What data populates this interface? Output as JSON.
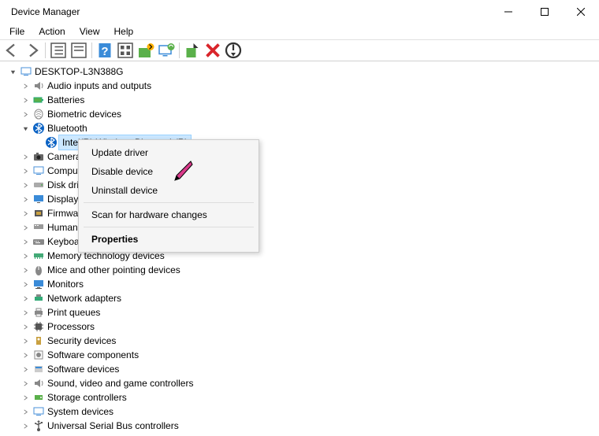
{
  "window": {
    "title": "Device Manager"
  },
  "menu": {
    "file": "File",
    "action": "Action",
    "view": "View",
    "help": "Help"
  },
  "tree": {
    "root": "DESKTOP-L3N388G",
    "audio": "Audio inputs and outputs",
    "batteries": "Batteries",
    "biometric": "Biometric devices",
    "bluetooth": "Bluetooth",
    "bt_device": "Intel(R) Wireless Bluetooth(R)",
    "cameras": "Cameras",
    "computer": "Computer",
    "disk": "Disk drives",
    "display": "Display adapters",
    "firmware": "Firmware",
    "hid": "Human Interface Devices",
    "keyboards": "Keyboards",
    "memory": "Memory technology devices",
    "mice": "Mice and other pointing devices",
    "monitors": "Monitors",
    "network": "Network adapters",
    "printqueues": "Print queues",
    "processors": "Processors",
    "security": "Security devices",
    "softcomp": "Software components",
    "softdev": "Software devices",
    "sound": "Sound, video and game controllers",
    "storage": "Storage controllers",
    "system": "System devices",
    "usb": "Universal Serial Bus controllers"
  },
  "context_menu": {
    "update_driver": "Update driver",
    "disable_device": "Disable device",
    "uninstall_device": "Uninstall device",
    "scan": "Scan for hardware changes",
    "properties": "Properties"
  }
}
